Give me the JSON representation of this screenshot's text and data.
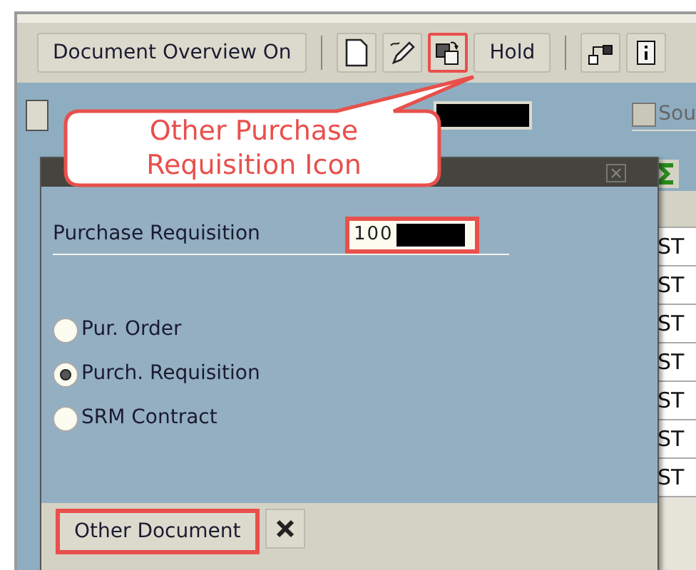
{
  "toolbar": [
    {
      "kind": "text",
      "label": "Document Overview On",
      "highlighted": false
    },
    {
      "kind": "separator"
    },
    {
      "kind": "new"
    },
    {
      "kind": "edit"
    },
    {
      "kind": "other",
      "highlighted": true
    },
    {
      "kind": "text",
      "label": "Hold",
      "highlighted": false
    },
    {
      "kind": "separator"
    },
    {
      "kind": "tree"
    },
    {
      "kind": "info"
    }
  ],
  "header": {
    "checkbox": {
      "label": "Sou",
      "checked": false
    }
  },
  "table": {
    "rows": [
      "ST",
      "ST",
      "ST",
      "ST",
      "ST",
      "ST",
      "ST"
    ]
  },
  "dialog": {
    "field": {
      "label": "Purchase Requisition",
      "value": "100",
      "highlighted": true
    },
    "options": [
      {
        "label": "Pur. Order",
        "selected": false
      },
      {
        "label": "Purch. Requisition",
        "selected": true
      },
      {
        "label": "SRM Contract",
        "selected": false
      }
    ],
    "buttons": [
      {
        "kind": "text",
        "label": "Other Document",
        "highlighted": true
      },
      {
        "kind": "cancel",
        "highlighted": false
      }
    ]
  },
  "callout": {
    "text": "Other Purchase Requisition Icon"
  }
}
